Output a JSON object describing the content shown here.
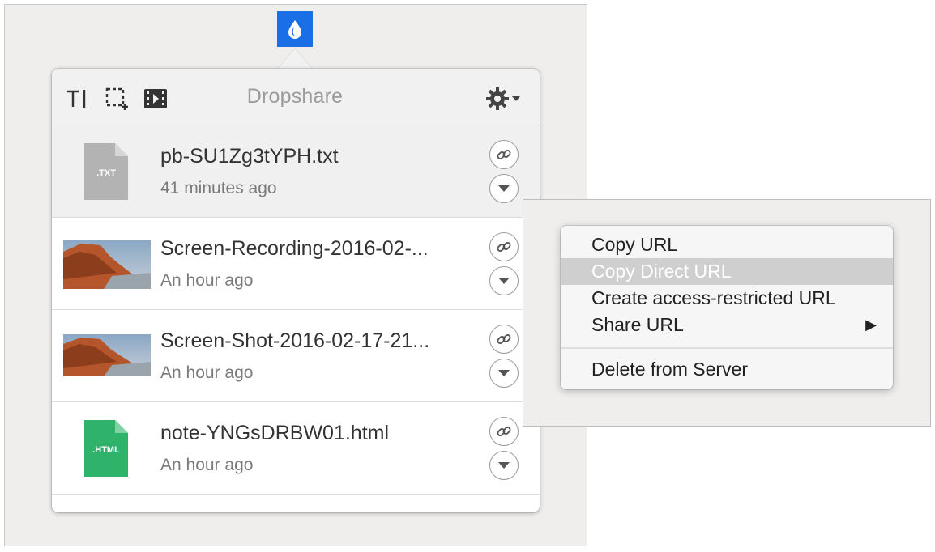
{
  "menubar": {
    "app_icon": "dropshare-drop-icon",
    "accent_color": "#1a6fe6"
  },
  "popover": {
    "title": "Dropshare",
    "toolbar": {
      "text_tool_icon": "text-cursor-icon",
      "screenshot_tool_icon": "selection-crop-icon",
      "recording_tool_icon": "film-strip-icon",
      "settings_icon": "gear-icon"
    },
    "files": [
      {
        "name": "pb-SU1Zg3tYPH.txt",
        "time": "41 minutes ago",
        "type": "txt",
        "badge": ".TXT"
      },
      {
        "name": "Screen-Recording-2016-02-...",
        "time": "An hour ago",
        "type": "image"
      },
      {
        "name": "Screen-Shot-2016-02-17-21...",
        "time": "An hour ago",
        "type": "image"
      },
      {
        "name": "note-YNGsDRBW01.html",
        "time": "An hour ago",
        "type": "html",
        "badge": ".HTML"
      }
    ]
  },
  "context_menu": {
    "items": [
      {
        "label": "Copy URL"
      },
      {
        "label": "Copy Direct URL"
      },
      {
        "label": "Create access-restricted URL"
      },
      {
        "label": "Share URL"
      },
      {
        "label": "Delete from Server"
      }
    ],
    "submenu_glyph": "▶"
  }
}
